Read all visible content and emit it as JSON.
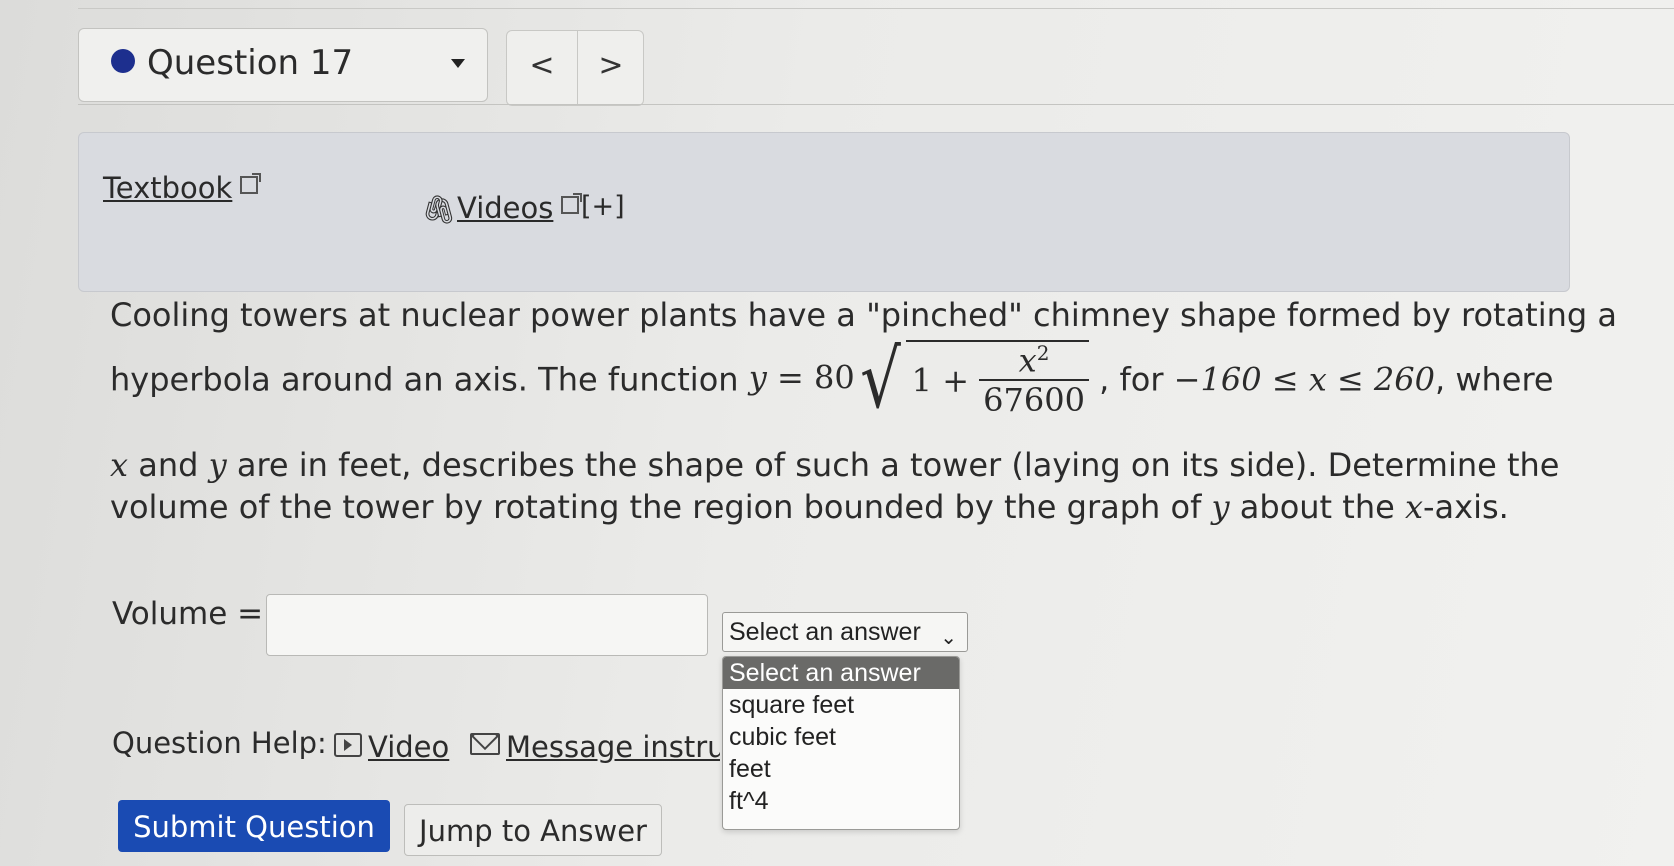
{
  "question_nav": {
    "title": "Question 17",
    "prev": "<",
    "next": ">"
  },
  "resources": {
    "textbook": "Textbook",
    "videos": "Videos",
    "expand": "[+]"
  },
  "problem": {
    "line1": "Cooling towers at nuclear power plants have a \"pinched\" chimney shape formed by rotating a",
    "line2_a": "hyperbola around an axis. The function",
    "eq_y": "y",
    "eq_equals": "=",
    "eq_coef": "80",
    "eq_one_plus": "1 +",
    "eq_num_var": "x",
    "eq_num_exp": "2",
    "eq_den": "67600",
    "line2_b": ", for",
    "ineq": "−160 ≤ x ≤ 260",
    "line2_c": ", where",
    "line3_x": "x",
    "line3_and": " and ",
    "line3_y": "y",
    "line3_rest": " are in feet, describes the shape of such a tower (laying on its side). Determine the",
    "line4_a": "volume of the tower by rotating the region bounded by the graph of ",
    "line4_y": "y",
    "line4_b": " about the ",
    "line4_x": "x",
    "line4_c": "-axis."
  },
  "answer": {
    "label": "Volume =",
    "value": "",
    "units_selected": "Select an answer",
    "units_options": [
      "Select an answer",
      "square feet",
      "cubic feet",
      "feet",
      "ft^4"
    ]
  },
  "help": {
    "label": "Question Help:",
    "video": "Video",
    "message": "Message instructor"
  },
  "buttons": {
    "submit": "Submit Question",
    "jump": "Jump to Answer"
  },
  "colors": {
    "submit_bg": "#1a4bb3",
    "question_dot": "#1d2f8e",
    "resource_panel": "#d9dbe0"
  }
}
